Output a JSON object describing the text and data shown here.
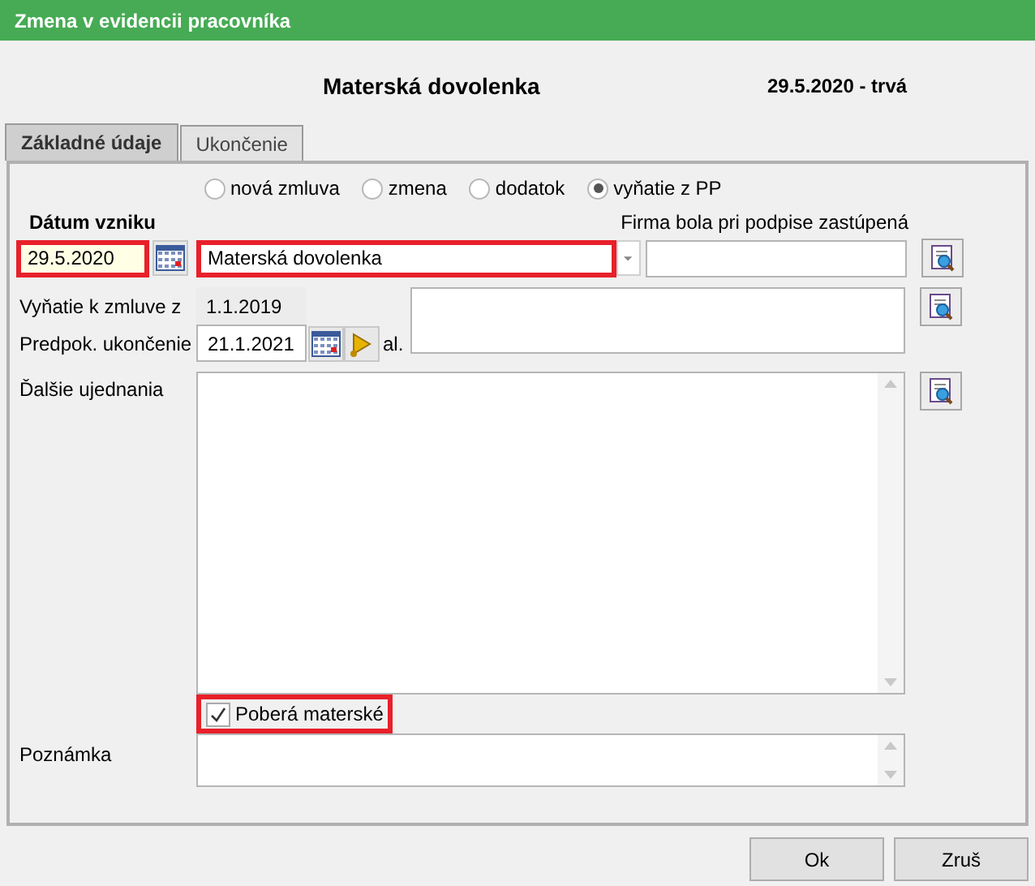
{
  "window": {
    "title": "Zmena v evidencii pracovníka"
  },
  "header": {
    "type": "Materská dovolenka",
    "period": "29.5.2020 - trvá"
  },
  "tabs": [
    {
      "label": "Základné údaje",
      "selected": true
    },
    {
      "label": "Ukončenie",
      "selected": false
    }
  ],
  "change_types": [
    {
      "label": "nová zmluva",
      "selected": false
    },
    {
      "label": "zmena",
      "selected": false
    },
    {
      "label": "dodatok",
      "selected": false
    },
    {
      "label": "vyňatie z PP",
      "selected": true
    }
  ],
  "start_date": {
    "label": "Dátum vzniku",
    "value": "29.5.2020",
    "highlighted": true
  },
  "reason": {
    "value": "Materská dovolenka",
    "highlighted": true
  },
  "represented": {
    "label": "Firma bola pri podpise zastúpená"
  },
  "exemption_from": {
    "label": "Vyňatie k zmluve z",
    "value": "1.1.2019"
  },
  "expected_end": {
    "label": "Predpok. ukončenie",
    "value": "21.1.2021",
    "suffix": "al."
  },
  "other_terms": {
    "label": "Ďalšie ujednania"
  },
  "maternity": {
    "label": "Poberá materské",
    "checked": true,
    "highlighted": true
  },
  "note": {
    "label": "Poznámka"
  },
  "buttons": [
    "Ok",
    "Zruš"
  ]
}
